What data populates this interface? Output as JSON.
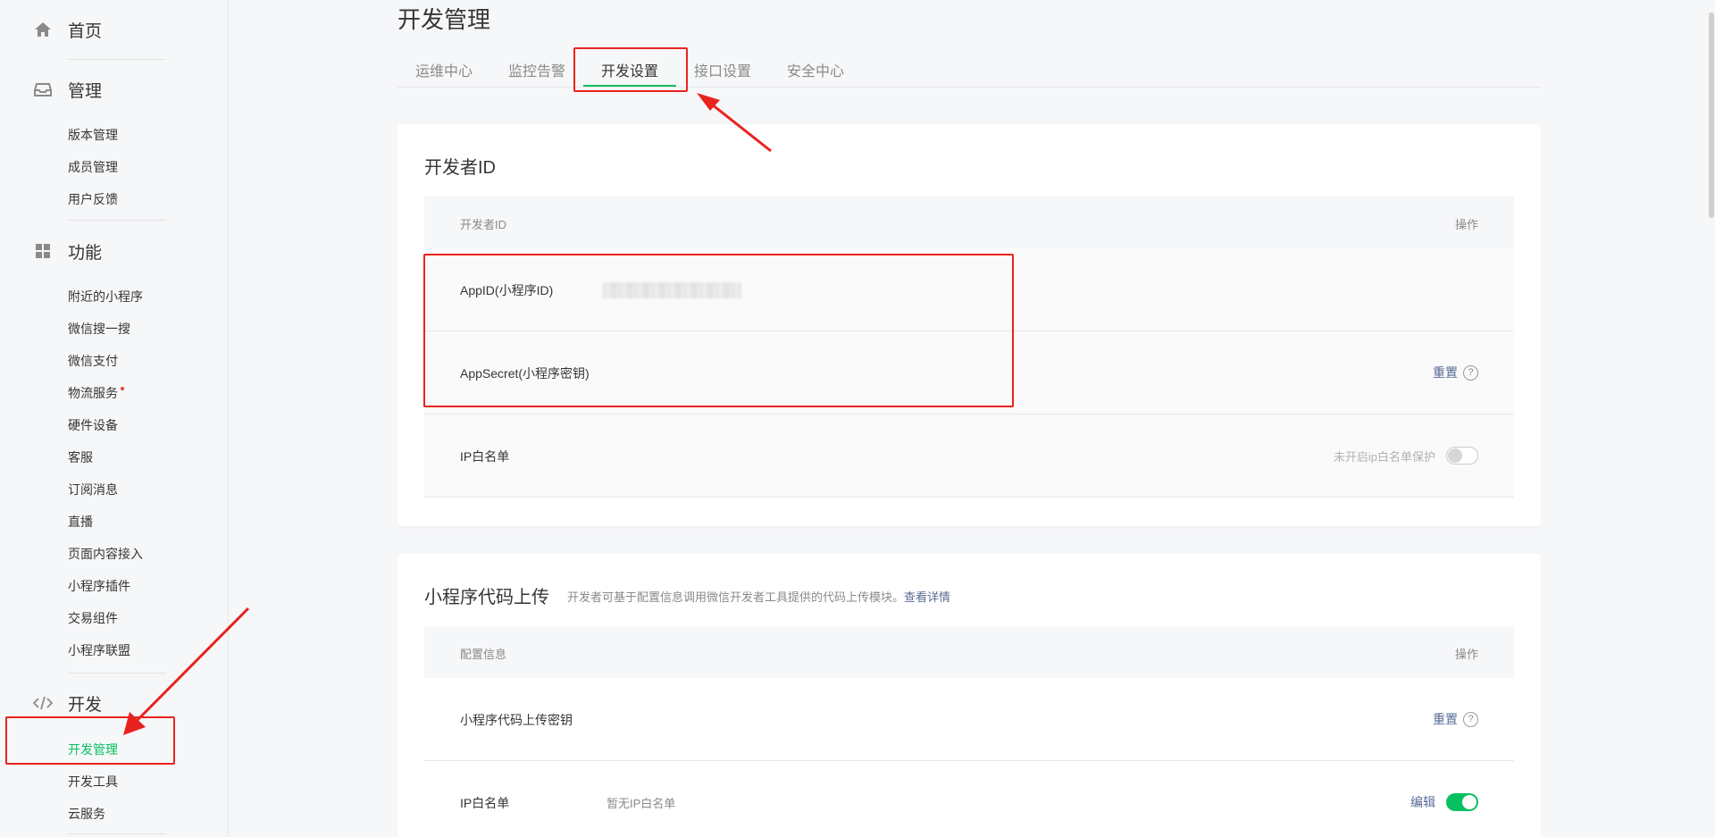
{
  "sidebar": {
    "home": "首页",
    "manage": {
      "title": "管理",
      "items": [
        "版本管理",
        "成员管理",
        "用户反馈"
      ]
    },
    "features": {
      "title": "功能",
      "items": [
        "附近的小程序",
        "微信搜一搜",
        "微信支付",
        "物流服务",
        "硬件设备",
        "客服",
        "订阅消息",
        "直播",
        "页面内容接入",
        "小程序插件",
        "交易组件",
        "小程序联盟"
      ]
    },
    "dev": {
      "title": "开发",
      "items": [
        "开发管理",
        "开发工具",
        "云服务"
      ]
    }
  },
  "main": {
    "title": "开发管理",
    "tabs": [
      "运维中心",
      "监控告警",
      "开发设置",
      "接口设置",
      "安全中心"
    ],
    "active_tab": 2
  },
  "dev_id_card": {
    "title": "开发者ID",
    "head_col1": "开发者ID",
    "head_col2": "操作",
    "appid_label": "AppID(小程序ID)",
    "appsecret_label": "AppSecret(小程序密钥)",
    "appsecret_action": "重置",
    "ip_label": "IP白名单",
    "ip_status": "未开启ip白名单保护",
    "ip_switch_on": false
  },
  "upload_card": {
    "title": "小程序代码上传",
    "desc": "开发者可基于配置信息调用微信开发者工具提供的代码上传模块。",
    "desc_link": "查看详情",
    "head_col1": "配置信息",
    "head_col2": "操作",
    "key_label": "小程序代码上传密钥",
    "key_action": "重置",
    "ip_label": "IP白名单",
    "ip_value": "暂无IP白名单",
    "ip_action": "编辑",
    "ip_switch_on": true
  },
  "colors": {
    "accent": "#07c160",
    "link": "#576b95",
    "annotation": "#e8231f"
  }
}
